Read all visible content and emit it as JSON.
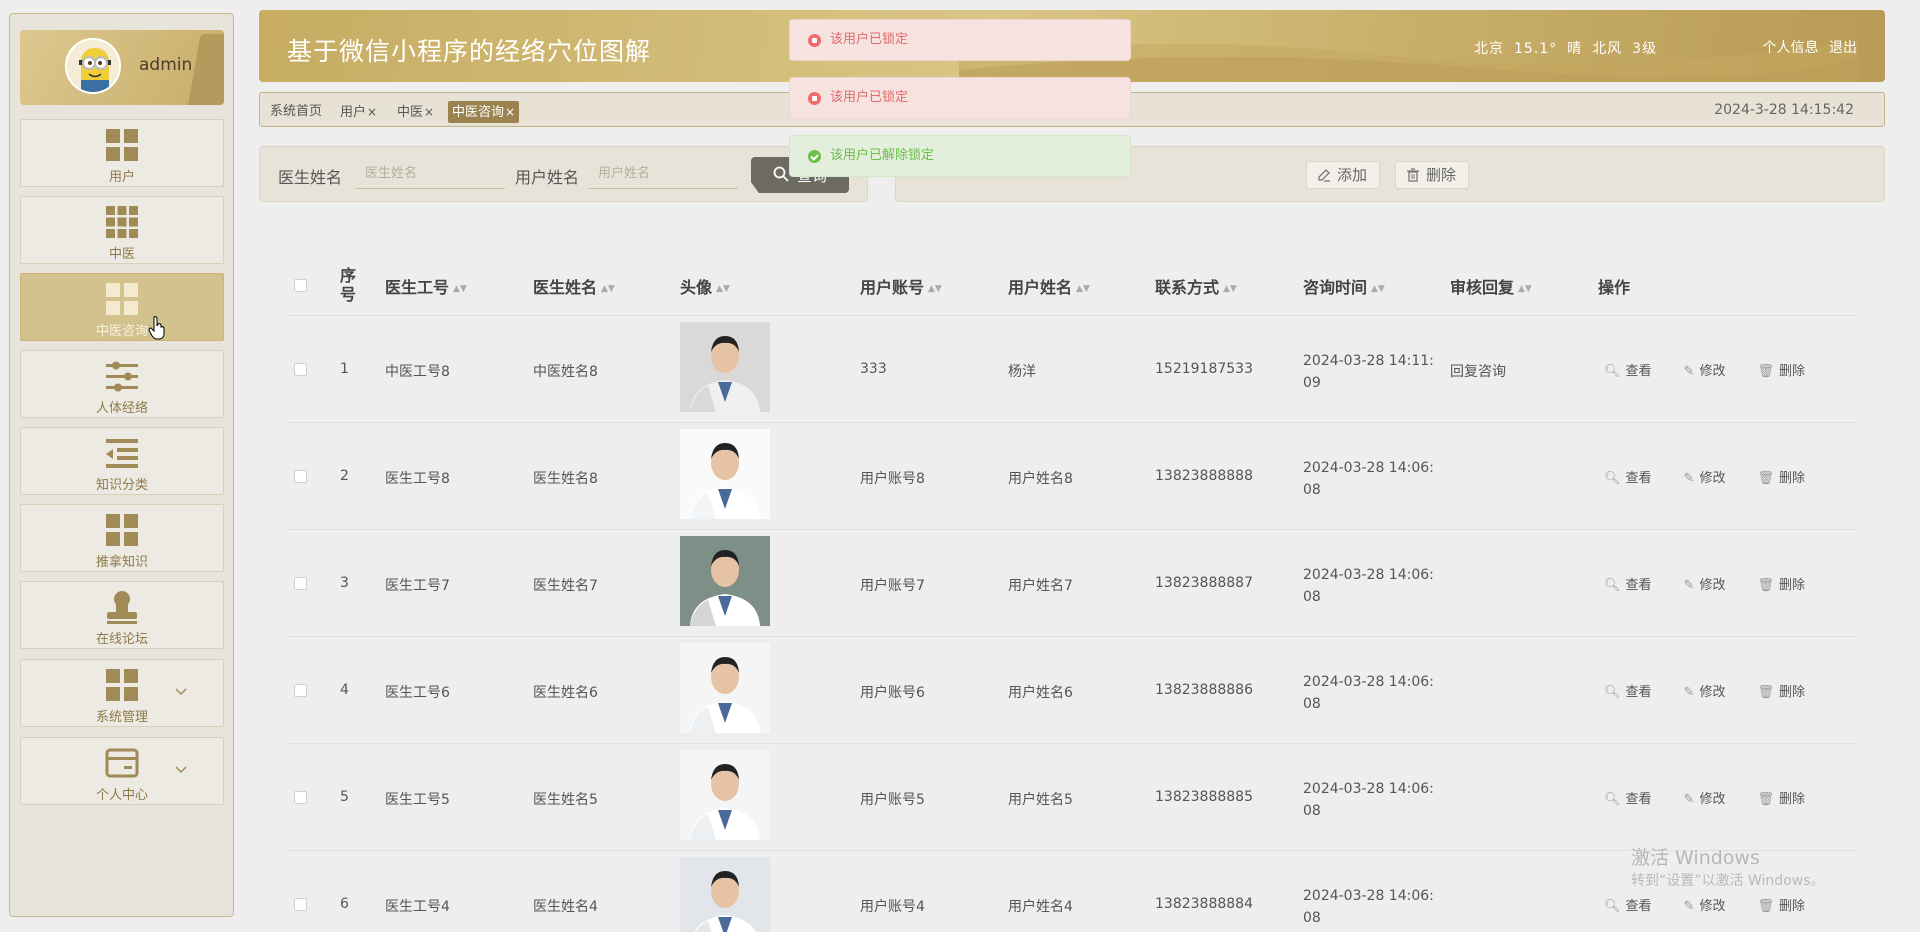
{
  "sidebar": {
    "admin_name": "admin",
    "items": [
      {
        "label": "用户",
        "icon": "grid-4-icon",
        "active": false
      },
      {
        "label": "中医",
        "icon": "grid-9-icon",
        "active": false
      },
      {
        "label": "中医咨询",
        "icon": "grid-4-icon",
        "active": true
      },
      {
        "label": "人体经络",
        "icon": "sliders-icon",
        "active": false
      },
      {
        "label": "知识分类",
        "icon": "list-indent-icon",
        "active": false
      },
      {
        "label": "推拿知识",
        "icon": "grid-4-icon",
        "active": false
      },
      {
        "label": "在线论坛",
        "icon": "user-stamp-icon",
        "active": false
      },
      {
        "label": "系统管理",
        "icon": "grid-4-icon",
        "active": false
      },
      {
        "label": "个人中心",
        "icon": "card-icon",
        "active": false
      }
    ]
  },
  "header": {
    "title": "基于微信小程序的经络穴位图解",
    "weather": {
      "city": "北京",
      "temp": "15.1°",
      "cond": "晴",
      "wind": "北风",
      "level": "3级"
    },
    "profile_link": "个人信息",
    "logout_link": "退出"
  },
  "tabs": {
    "items": [
      "系统首页",
      "用户",
      "中医",
      "中医咨询"
    ],
    "close": "×",
    "datetime": "2024-3-28 14:15:42"
  },
  "search": {
    "doctor_label": "医生姓名",
    "doctor_placeholder": "医生姓名",
    "user_label": "用户姓名",
    "user_placeholder": "用户姓名",
    "query_label": "查询"
  },
  "actions": {
    "add_label": "添加",
    "delete_label": "删除"
  },
  "toasts": [
    {
      "type": "error",
      "text": "该用户已锁定"
    },
    {
      "type": "error",
      "text": "该用户已锁定"
    },
    {
      "type": "success",
      "text": "该用户已解除锁定"
    }
  ],
  "table": {
    "columns": [
      "序号",
      "医生工号",
      "医生姓名",
      "头像",
      "用户账号",
      "用户姓名",
      "联系方式",
      "咨询时间",
      "审核回复",
      "操作"
    ],
    "row_actions": {
      "view": "查看",
      "edit": "修改",
      "delete": "删除"
    },
    "rows": [
      {
        "index": "1",
        "doctor_no": "中医工号8",
        "doctor_name": "中医姓名8",
        "account": "333",
        "user_name": "杨洋",
        "phone": "15219187533",
        "time_a": "2024-03-28 14:11:",
        "time_b": "09",
        "reply": "回复咨询"
      },
      {
        "index": "2",
        "doctor_no": "医生工号8",
        "doctor_name": "医生姓名8",
        "account": "用户账号8",
        "user_name": "用户姓名8",
        "phone": "13823888888",
        "time_a": "2024-03-28 14:06:",
        "time_b": "08",
        "reply": ""
      },
      {
        "index": "3",
        "doctor_no": "医生工号7",
        "doctor_name": "医生姓名7",
        "account": "用户账号7",
        "user_name": "用户姓名7",
        "phone": "13823888887",
        "time_a": "2024-03-28 14:06:",
        "time_b": "08",
        "reply": ""
      },
      {
        "index": "4",
        "doctor_no": "医生工号6",
        "doctor_name": "医生姓名6",
        "account": "用户账号6",
        "user_name": "用户姓名6",
        "phone": "13823888886",
        "time_a": "2024-03-28 14:06:",
        "time_b": "08",
        "reply": ""
      },
      {
        "index": "5",
        "doctor_no": "医生工号5",
        "doctor_name": "医生姓名5",
        "account": "用户账号5",
        "user_name": "用户姓名5",
        "phone": "13823888885",
        "time_a": "2024-03-28 14:06:",
        "time_b": "08",
        "reply": ""
      },
      {
        "index": "6",
        "doctor_no": "医生工号4",
        "doctor_name": "医生姓名4",
        "account": "用户账号4",
        "user_name": "用户姓名4",
        "phone": "13823888884",
        "time_a": "2024-03-28 14:06:",
        "time_b": "08",
        "reply": ""
      }
    ]
  },
  "watermark": {
    "line1": "激活 Windows",
    "line2": "转到“设置”以激活 Windows。"
  },
  "colors": {
    "accent": "#c8ad6a",
    "accent_dark": "#9a834f",
    "sidebar_bg": "#e8e4dc"
  }
}
